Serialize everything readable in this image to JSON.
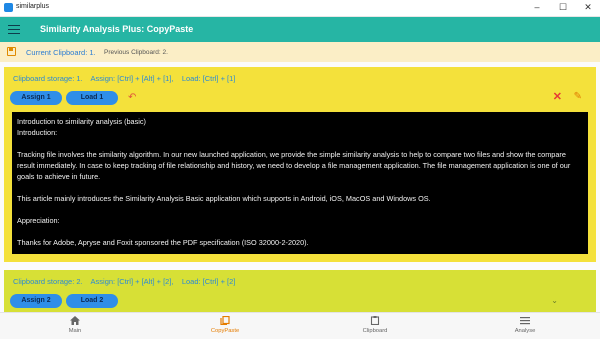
{
  "window": {
    "title": "similarplus"
  },
  "appbar": {
    "title": "Similarity Analysis Plus: CopyPaste"
  },
  "clipboard_status": {
    "current": "Current Clipboard: 1.",
    "previous": "Previous Clipboard: 2."
  },
  "cards": [
    {
      "storage_label": "Clipboard storage: 1.    Assign: [Ctrl] + [Alt] + [1],    Load: [Ctrl] + [1]",
      "assign_label": "Assign 1",
      "load_label": "Load 1",
      "content": [
        "Introduction to similarity analysis (basic)",
        "Introduction:",
        "Tracking file involves the similarity algorithm. In our new launched application, we provide the simple similarity analysis to help to compare two files and show the compare result immediately. In case to keep tracking of file relationship and history, we need to develop a file management application. The file management application is one of our goals to achieve in future.",
        "This article mainly introduces the Similarity Analysis Basic application which supports in Android, iOS, MacOS and Windows OS.",
        "Appreciation:",
        "Thanks for Adobe, Apryse and Foxit sponsored the PDF specification (ISO 32000-2-2020)."
      ]
    },
    {
      "storage_label": "Clipboard storage: 2.    Assign: [Ctrl] + [Alt] + [2],    Load: [Ctrl] + [2]",
      "assign_label": "Assign 2",
      "load_label": "Load 2"
    }
  ],
  "bottom_nav": [
    {
      "label": "Main",
      "icon": "home-icon",
      "active": false
    },
    {
      "label": "CopyPaste",
      "icon": "copy-icon",
      "active": true
    },
    {
      "label": "Clipboard",
      "icon": "clipboard-icon",
      "active": false
    },
    {
      "label": "Analyse",
      "icon": "menu-lines-icon",
      "active": false
    }
  ],
  "colors": {
    "appbar": "#26b5a4",
    "card1": "#f4e13b",
    "card2": "#d7e036",
    "accent_blue": "#2f8ee8",
    "active_nav": "#e57c00"
  }
}
